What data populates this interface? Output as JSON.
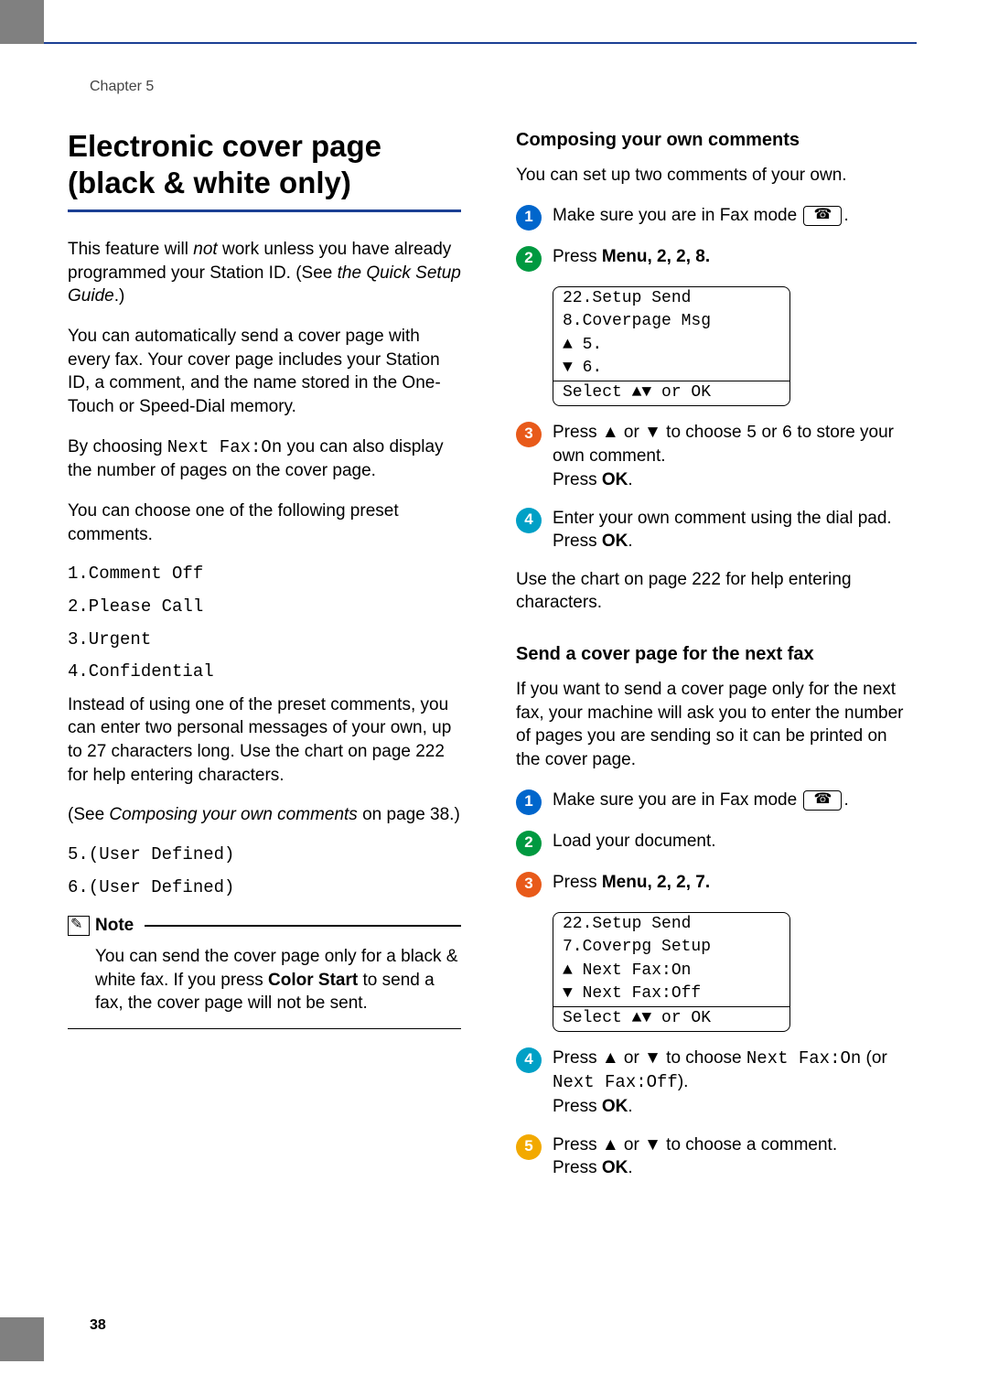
{
  "chapter": "Chapter 5",
  "page_number": "38",
  "left": {
    "title_line1": "Electronic cover page",
    "title_line2": "(black & white only)",
    "p1a": "This feature will ",
    "p1_not": "not",
    "p1b": " work unless you have already programmed your Station ID. (See ",
    "p1_qsg": "the Quick Setup Guide",
    "p1c": ".)",
    "p2": "You can automatically send a cover page with every fax. Your cover page includes your Station ID, a comment, and the name stored in the One-Touch or Speed-Dial memory.",
    "p3a": "By choosing ",
    "p3_mono": "Next Fax:On",
    "p3b": " you can also display the number of pages on the cover page.",
    "p4": "You can choose one of the following preset comments.",
    "presets": {
      "c1": "1.Comment Off",
      "c2": "2.Please Call",
      "c3": "3.Urgent",
      "c4": "4.Confidential"
    },
    "p5": "Instead of using one of the preset comments, you can enter two personal messages of your own, up to 27 characters long. Use the chart on page 222 for help entering characters.",
    "p6a": "(See ",
    "p6_i": "Composing your own comments",
    "p6b": " on page 38.)",
    "user1": "5.(User Defined)",
    "user2": "6.(User Defined)",
    "note_title": "Note",
    "note_body_a": "You can send the cover page only for a black & white fax. If you press ",
    "note_bold": "Color Start",
    "note_body_b": " to send a fax, the cover page will not be sent."
  },
  "right": {
    "sec1_title": "Composing your own comments",
    "sec1_intro": "You can set up two comments of your own.",
    "sec1": {
      "s1": "Make sure you are in Fax mode ",
      "s2a": "Press ",
      "s2_menu": "Menu",
      "s2_keys": ", 2, 2, 8.",
      "lcd1_l1": "22.Setup Send",
      "lcd1_l2": "  8.Coverpage Msg",
      "lcd1_l3": "▲     5.",
      "lcd1_l4": "▼     6.",
      "lcd1_sel": "Select ▲▼ or OK",
      "s3a": "Press ▲ or ▼ to choose ",
      "s3_5": "5",
      "s3_or": " or ",
      "s3_6": "6",
      "s3b": " to store your own comment.",
      "s3c": "Press ",
      "s3_ok": "OK",
      "s4a": "Enter your own comment using the dial pad.",
      "s4b": "Press ",
      "s4_ok": "OK"
    },
    "sec1_outro": "Use the chart on page 222 for help entering characters.",
    "sec2_title": "Send a cover page for the next fax",
    "sec2_intro": "If you want to send a cover page only for the next fax, your machine will ask you to enter the number of pages you are sending so it can be printed on the cover page.",
    "sec2": {
      "s1": "Make sure you are in Fax mode ",
      "s2": "Load your document.",
      "s3a": "Press ",
      "s3_menu": "Menu",
      "s3_keys": ", 2, 2, 7.",
      "lcd2_l1": "22.Setup Send",
      "lcd2_l2": "  7.Coverpg Setup",
      "lcd2_l3": "▲    Next Fax:On",
      "lcd2_l4": "▼    Next Fax:Off",
      "lcd2_sel": "Select ▲▼ or OK",
      "s4a": "Press ▲ or ▼ to choose ",
      "s4_on": "Next Fax:On",
      "s4b": " (or ",
      "s4_off": "Next Fax:Off",
      "s4c": ").",
      "s4d": "Press ",
      "s4_ok": "OK",
      "s5a": "Press ▲ or ▼ to choose a comment.",
      "s5b": "Press ",
      "s5_ok": "OK"
    }
  }
}
